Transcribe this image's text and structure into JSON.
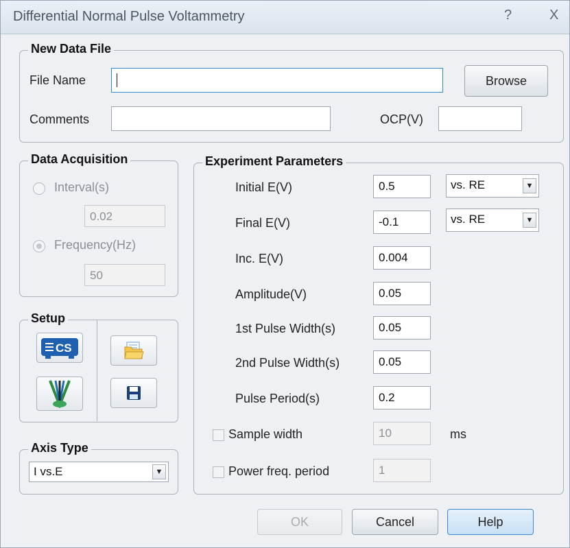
{
  "window": {
    "title": "Differential Normal Pulse Voltammetry",
    "help_glyph": "?",
    "close_glyph": "X"
  },
  "new_data_file": {
    "legend": "New Data File",
    "file_name_label": "File Name",
    "file_name_value": "",
    "browse_label": "Browse",
    "comments_label": "Comments",
    "comments_value": "",
    "ocp_label": "OCP(V)",
    "ocp_value": ""
  },
  "data_acquisition": {
    "legend": "Data Acquisition",
    "interval_label": "Interval(s)",
    "interval_value": "0.02",
    "frequency_label": "Frequency(Hz)",
    "frequency_value": "50",
    "selected": "frequency"
  },
  "setup": {
    "legend": "Setup",
    "cs_icon_text": "CS",
    "icons": [
      "cs-device-icon",
      "open-folder-icon",
      "electrode-icon",
      "save-disk-icon"
    ]
  },
  "axis_type": {
    "legend": "Axis Type",
    "value": "I vs.E"
  },
  "experiment": {
    "legend": "Experiment Parameters",
    "params": [
      {
        "label": "Initial E(V)",
        "value": "0.5",
        "ref": "vs. RE"
      },
      {
        "label": "Final E(V)",
        "value": "-0.1",
        "ref": "vs. RE"
      },
      {
        "label": "Inc. E(V)",
        "value": "0.004"
      },
      {
        "label": "Amplitude(V)",
        "value": "0.05"
      },
      {
        "label": "1st Pulse Width(s)",
        "value": "0.05"
      },
      {
        "label": "2nd Pulse Width(s)",
        "value": "0.05"
      },
      {
        "label": "Pulse Period(s)",
        "value": "0.2"
      }
    ],
    "sample_width_label": "Sample width",
    "sample_width_value": "10",
    "sample_width_unit": "ms",
    "power_freq_label": "Power freq. period",
    "power_freq_value": "1"
  },
  "buttons": {
    "ok": "OK",
    "cancel": "Cancel",
    "help": "Help"
  },
  "colors": {
    "accent": "#2f8ad8",
    "cs_icon_blue": "#1f5fb0",
    "dialog_bg": "#eef0f3"
  }
}
